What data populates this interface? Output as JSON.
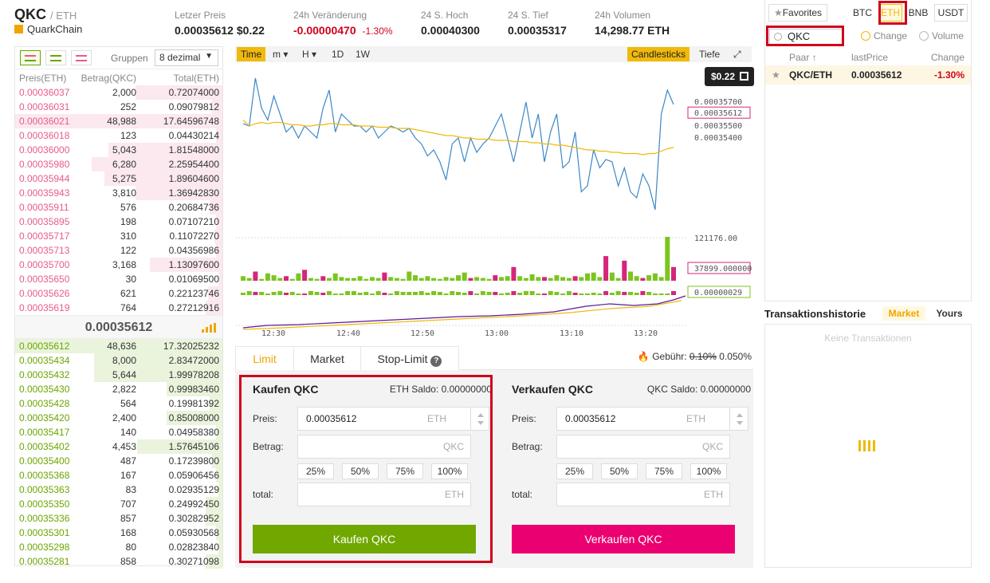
{
  "header": {
    "symbol": "QKC",
    "quote": "/ ETH",
    "coin_name": "QuarkChain",
    "stats": [
      {
        "label": "Letzer Preis",
        "value": "0.00035612",
        "extra": "$0.22"
      },
      {
        "label": "24h Veränderung",
        "value": "-0.00000470",
        "extra": "-1.30%"
      },
      {
        "label": "24 S. Hoch",
        "value": "0.00040300"
      },
      {
        "label": "24 S. Tief",
        "value": "0.00035317"
      },
      {
        "label": "24h Volumen",
        "value": "14,298.77 ETH"
      }
    ]
  },
  "orderbook": {
    "group_label": "Gruppen",
    "group_value": "8 dezimal",
    "headers": [
      "Preis(ETH)",
      "Betrag(QKC)",
      "Total(ETH)"
    ],
    "asks": [
      {
        "price": "0.00036037",
        "amount": "2,000",
        "total": "0.72074000",
        "depth": 0.42
      },
      {
        "price": "0.00036031",
        "amount": "252",
        "total": "0.09079812",
        "depth": 0.05
      },
      {
        "price": "0.00036021",
        "amount": "48,988",
        "total": "17.64596748",
        "depth": 1.0
      },
      {
        "price": "0.00036018",
        "amount": "123",
        "total": "0.04430214",
        "depth": 0.03
      },
      {
        "price": "0.00036000",
        "amount": "5,043",
        "total": "1.81548000",
        "depth": 0.55
      },
      {
        "price": "0.00035980",
        "amount": "6,280",
        "total": "2.25954400",
        "depth": 0.63
      },
      {
        "price": "0.00035944",
        "amount": "5,275",
        "total": "1.89604600",
        "depth": 0.57
      },
      {
        "price": "0.00035943",
        "amount": "3,810",
        "total": "1.36942830",
        "depth": 0.42
      },
      {
        "price": "0.00035911",
        "amount": "576",
        "total": "0.20684736",
        "depth": 0.06
      },
      {
        "price": "0.00035895",
        "amount": "198",
        "total": "0.07107210",
        "depth": 0.03
      },
      {
        "price": "0.00035717",
        "amount": "310",
        "total": "0.11072270",
        "depth": 0.04
      },
      {
        "price": "0.00035713",
        "amount": "122",
        "total": "0.04356986",
        "depth": 0.03
      },
      {
        "price": "0.00035700",
        "amount": "3,168",
        "total": "1.13097600",
        "depth": 0.35
      },
      {
        "price": "0.00035650",
        "amount": "30",
        "total": "0.01069500",
        "depth": 0.02
      },
      {
        "price": "0.00035626",
        "amount": "621",
        "total": "0.22123746",
        "depth": 0.07
      },
      {
        "price": "0.00035619",
        "amount": "764",
        "total": "0.27212916",
        "depth": 0.08
      }
    ],
    "last_price": "0.00035612",
    "bids": [
      {
        "price": "0.00035612",
        "amount": "48,636",
        "total": "17.32025232",
        "depth": 1.0
      },
      {
        "price": "0.00035434",
        "amount": "8,000",
        "total": "2.83472000",
        "depth": 0.62
      },
      {
        "price": "0.00035432",
        "amount": "5,644",
        "total": "1.99978208",
        "depth": 0.62
      },
      {
        "price": "0.00035430",
        "amount": "2,822",
        "total": "0.99983460",
        "depth": 0.27
      },
      {
        "price": "0.00035428",
        "amount": "564",
        "total": "0.19981392",
        "depth": 0.06
      },
      {
        "price": "0.00035420",
        "amount": "2,400",
        "total": "0.85008000",
        "depth": 0.27
      },
      {
        "price": "0.00035417",
        "amount": "140",
        "total": "0.04958380",
        "depth": 0.03
      },
      {
        "price": "0.00035402",
        "amount": "4,453",
        "total": "1.57645106",
        "depth": 0.41
      },
      {
        "price": "0.00035400",
        "amount": "487",
        "total": "0.17239800",
        "depth": 0.05
      },
      {
        "price": "0.00035368",
        "amount": "167",
        "total": "0.05906456",
        "depth": 0.03
      },
      {
        "price": "0.00035363",
        "amount": "83",
        "total": "0.02935129",
        "depth": 0.02
      },
      {
        "price": "0.00035350",
        "amount": "707",
        "total": "0.24992450",
        "depth": 0.08
      },
      {
        "price": "0.00035336",
        "amount": "857",
        "total": "0.30282952",
        "depth": 0.08
      },
      {
        "price": "0.00035301",
        "amount": "168",
        "total": "0.05930568",
        "depth": 0.03
      },
      {
        "price": "0.00035298",
        "amount": "80",
        "total": "0.02823840",
        "depth": 0.02
      },
      {
        "price": "0.00035281",
        "amount": "858",
        "total": "0.30271098",
        "depth": 0.08
      }
    ]
  },
  "chart": {
    "toolbar": [
      "Time",
      "m",
      "H",
      "1D",
      "1W"
    ],
    "views": [
      "Candlesticks",
      "Tiefe"
    ],
    "price_pill": "$0.22",
    "price_ticks": [
      "0.00035700",
      "0.00035500",
      "0.00035400"
    ],
    "current_label": "0.00035612",
    "volume_ticks": [
      "121176.00",
      "37899.000000",
      "0.00000029"
    ],
    "time_ticks": [
      "12:30",
      "12:40",
      "12:50",
      "13:00",
      "13:10",
      "13:20"
    ],
    "price_series": [
      0.0003552,
      0.000355,
      0.000359,
      0.0003565,
      0.0003555,
      0.0003575,
      0.000356,
      0.0003545,
      0.000355,
      0.000354,
      0.000355,
      0.0003545,
      0.000354,
      0.0003565,
      0.000358,
      0.0003545,
      0.000356,
      0.0003555,
      0.000355,
      0.000355,
      0.0003545,
      0.000355,
      0.000354,
      0.0003545,
      0.000355,
      0.0003548,
      0.0003545,
      0.0003548,
      0.000354,
      0.0003535,
      0.0003525,
      0.000353,
      0.000352,
      0.0003505,
      0.0003535,
      0.000354,
      0.000352,
      0.000354,
      0.0003528,
      0.0003535,
      0.000354,
      0.000355,
      0.000356,
      0.000354,
      0.000352,
      0.0003545,
      0.000357,
      0.000354,
      0.000356,
      0.000352,
      0.0003545,
      0.000356,
      0.0003515,
      0.000352,
      0.0003545,
      0.0003495,
      0.00035,
      0.000353,
      0.0003515,
      0.0003522,
      0.000352,
      0.00035,
      0.0003515,
      0.0003495,
      0.000349,
      0.000351,
      0.00035,
      0.000348,
      0.000356,
      0.000358,
      0.0003568
    ],
    "ma_series": [
      0.0003555,
      0.000355,
      0.0003552,
      0.0003553,
      0.0003552,
      0.0003553,
      0.0003553,
      0.0003552,
      0.0003551,
      0.0003551,
      0.000355,
      0.000355,
      0.0003551,
      0.0003551,
      0.0003552,
      0.0003552,
      0.0003551,
      0.0003551,
      0.0003551,
      0.000355,
      0.000355,
      0.000355,
      0.0003549,
      0.0003549,
      0.0003549,
      0.0003548,
      0.0003548,
      0.0003548,
      0.0003547,
      0.0003546,
      0.0003545,
      0.0003544,
      0.0003543,
      0.0003542,
      0.0003542,
      0.0003541,
      0.000354,
      0.000354,
      0.0003539,
      0.0003539,
      0.0003539,
      0.0003538,
      0.0003538,
      0.0003538,
      0.0003537,
      0.0003537,
      0.0003537,
      0.0003536,
      0.0003536,
      0.0003535,
      0.0003535,
      0.0003534,
      0.0003534,
      0.0003533,
      0.0003532,
      0.0003531,
      0.000353,
      0.000353,
      0.0003529,
      0.0003529,
      0.0003528,
      0.0003528,
      0.0003527,
      0.0003527,
      0.0003527,
      0.0003526,
      0.0003527,
      0.0003527,
      0.0003529,
      0.0003531,
      0.0003532
    ],
    "volumes": [
      5,
      3,
      10,
      2,
      8,
      6,
      3,
      5,
      2,
      8,
      12,
      3,
      2,
      5,
      3,
      8,
      4,
      3,
      3,
      5,
      2,
      4,
      3,
      9,
      4,
      3,
      2,
      10,
      6,
      3,
      5,
      3,
      2,
      4,
      3,
      6,
      9,
      3,
      4,
      3,
      2,
      6,
      4,
      5,
      15,
      5,
      3,
      7,
      4,
      4,
      3,
      6,
      4,
      3,
      5,
      4,
      8,
      9,
      4,
      27,
      9,
      3,
      22,
      10,
      5,
      3,
      6,
      8,
      4,
      48,
      15
    ],
    "vol_colors": [
      "g",
      "g",
      "r",
      "g",
      "g",
      "g",
      "g",
      "r",
      "g",
      "g",
      "r",
      "g",
      "g",
      "r",
      "g",
      "g",
      "g",
      "g",
      "g",
      "g",
      "g",
      "g",
      "g",
      "r",
      "g",
      "g",
      "g",
      "g",
      "g",
      "g",
      "g",
      "g",
      "g",
      "g",
      "g",
      "g",
      "g",
      "r",
      "g",
      "g",
      "g",
      "r",
      "g",
      "g",
      "r",
      "g",
      "g",
      "g",
      "g",
      "r",
      "g",
      "g",
      "g",
      "g",
      "r",
      "g",
      "g",
      "g",
      "g",
      "r",
      "g",
      "g",
      "r",
      "g",
      "g",
      "r",
      "g",
      "g",
      "g",
      "g",
      "r"
    ]
  },
  "order_form": {
    "tabs": [
      "Limit",
      "Market",
      "Stop-Limit"
    ],
    "fee_label": "Gebühr:",
    "fee_old": "0.10%",
    "fee_new": "0.050%",
    "buy": {
      "title": "Kaufen QKC",
      "balance": "ETH Saldo: 0.00000000",
      "price_label": "Preis:",
      "price_value": "0.00035612",
      "price_unit": "ETH",
      "amount_label": "Betrag:",
      "amount_unit": "QKC",
      "total_label": "total:",
      "total_unit": "ETH",
      "percents": [
        "25%",
        "50%",
        "75%",
        "100%"
      ],
      "button": "Kaufen QKC"
    },
    "sell": {
      "title": "Verkaufen QKC",
      "balance": "QKC Saldo: 0.00000000",
      "price_label": "Preis:",
      "price_value": "0.00035612",
      "price_unit": "ETH",
      "amount_label": "Betrag:",
      "amount_unit": "QKC",
      "total_label": "total:",
      "total_unit": "ETH",
      "percents": [
        "25%",
        "50%",
        "75%",
        "100%"
      ],
      "button": "Verkaufen QKC"
    },
    "colors": {
      "buy": "#70a800",
      "sell": "#ea0070"
    }
  },
  "markets": {
    "favorites": "Favorites",
    "quotes": [
      "BTC",
      "ETH",
      "BNB",
      "USDT"
    ],
    "search_value": "QKC",
    "radio_change": "Change",
    "radio_volume": "Volume",
    "headers": [
      "Paar",
      "lastPrice",
      "Change"
    ],
    "rows": [
      {
        "pair": "QKC/ETH",
        "price": "0.00035612",
        "change": "-1.30%"
      }
    ]
  },
  "history": {
    "title": "Transaktionshistorie",
    "tabs": [
      "Market",
      "Yours"
    ],
    "empty": "Keine Transaktionen"
  }
}
